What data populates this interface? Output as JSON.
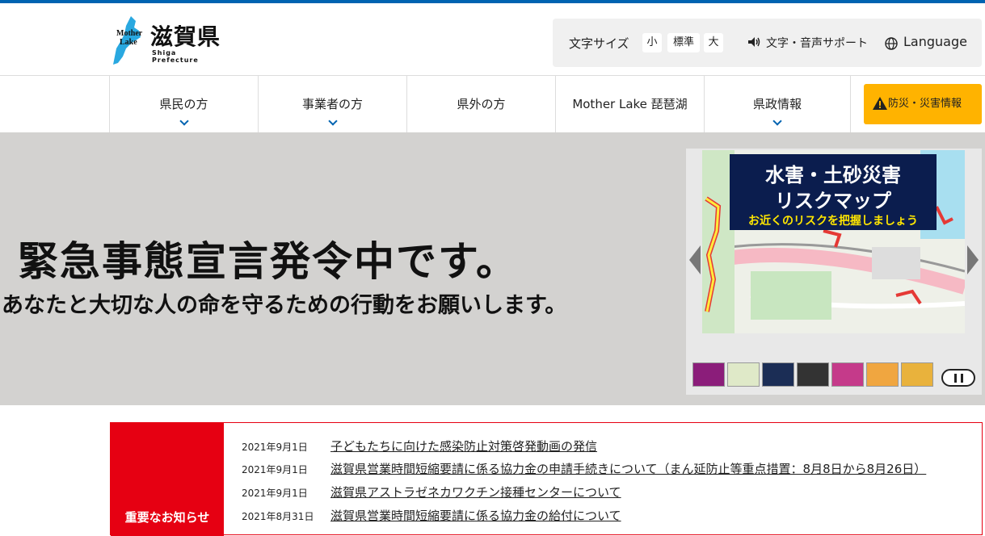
{
  "header": {
    "logo": {
      "name": "滋賀県",
      "sub": "Shiga Prefecture",
      "mother": "Mother",
      "lake": "Lake"
    },
    "font_size": {
      "label": "文字サイズ",
      "small": "小",
      "standard": "標準",
      "large": "大"
    },
    "voice_support": "文字・音声サポート",
    "language": "Language"
  },
  "nav": {
    "items": [
      {
        "label": "県民の方"
      },
      {
        "label": "事業者の方"
      },
      {
        "label": "県外の方"
      },
      {
        "label": "Mother Lake 琵琶湖"
      },
      {
        "label": "県政情報"
      }
    ],
    "disaster_button": "防災・災害情報"
  },
  "hero": {
    "title": "緊急事態宣言発令中です。",
    "subtitle": "あなたと大切な人の命を守るための行動をお願いします。"
  },
  "carousel": {
    "slide": {
      "line1": "水害・土砂災害",
      "line2": "リスクマップ",
      "line3": "お近くのリスクを把握しましょう"
    }
  },
  "notices": {
    "heading": "重要なお知らせ",
    "items": [
      {
        "date": "2021年9月1日",
        "title": "子どもたちに向けた感染防止対策啓発動画の発信"
      },
      {
        "date": "2021年9月1日",
        "title": "滋賀県営業時間短縮要請に係る協力金の申請手続きについて（まん延防止等重点措置：8月8日から8月26日）"
      },
      {
        "date": "2021年9月1日",
        "title": "滋賀県アストラゼネカワクチン接種センターについて"
      },
      {
        "date": "2021年8月31日",
        "title": "滋賀県営業時間短縮要請に係る協力金の給付について"
      }
    ]
  },
  "colors": {
    "brand_blue": "#0063b1",
    "alert_red": "#e60012",
    "disaster_orange": "#ffb300",
    "hero_gray": "#d3d2d0"
  }
}
